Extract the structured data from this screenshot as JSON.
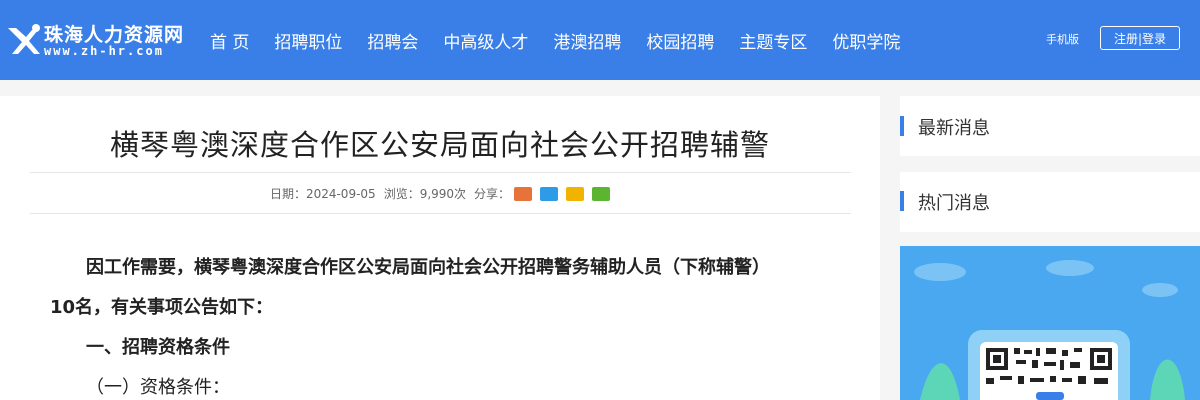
{
  "header": {
    "logo_title": "珠海人力资源网",
    "logo_sub": "www.zh-hr.com",
    "nav": [
      "首 页",
      "招聘职位",
      "招聘会",
      "中高级人才",
      "港澳招聘",
      "校园招聘",
      "主题专区",
      "优职学院"
    ],
    "mobile_label": "手机版",
    "login_label": "注册|登录"
  },
  "article": {
    "title": "横琴粤澳深度合作区公安局面向社会公开招聘辅警",
    "meta_date": "日期：2024-09-05",
    "meta_views": "浏览：9,990次",
    "meta_share": "分享：",
    "share_icons": [
      "weibo-icon",
      "qq-icon",
      "qzone-icon",
      "wechat-icon"
    ],
    "share_colors": [
      "#e8733a",
      "#2d9be8",
      "#f0b400",
      "#5cb531"
    ],
    "para1": "因工作需要，横琴粤澳深度合作区公安局面向社会公开招聘警务辅助人员（下称辅警）10名，有关事项公告如下：",
    "heading1": "一、招聘资格条件",
    "sub1": "（一）资格条件："
  },
  "sidebar": {
    "latest_title": "最新消息",
    "hot_title": "热门消息"
  },
  "colors": {
    "brand": "#3a7fe8"
  }
}
